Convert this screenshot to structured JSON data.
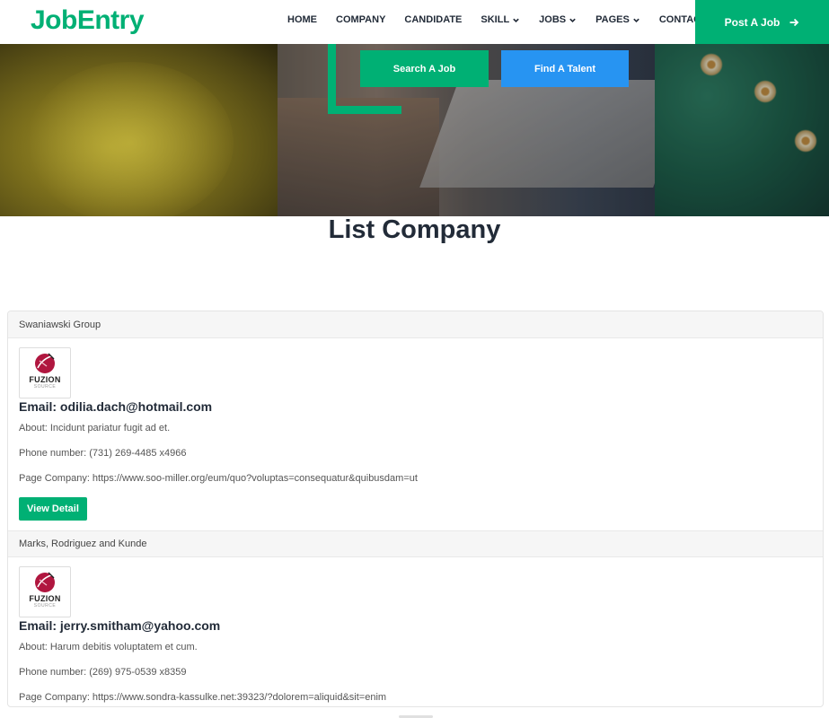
{
  "brand": {
    "logo": "JobEntry",
    "accent": "#00b074",
    "blue": "#2794f2"
  },
  "nav": {
    "items": [
      {
        "label": "HOME",
        "dropdown": false
      },
      {
        "label": "COMPANY",
        "dropdown": false
      },
      {
        "label": "CANDIDATE",
        "dropdown": false
      },
      {
        "label": "SKILL",
        "dropdown": true
      },
      {
        "label": "JOBS",
        "dropdown": true
      },
      {
        "label": "PAGES",
        "dropdown": true
      },
      {
        "label": "CONTACT",
        "dropdown": false
      }
    ],
    "post_job": "Post A Job",
    "post_job_icon": "arrow-right-icon"
  },
  "hero": {
    "search_job": "Search A Job",
    "find_talent": "Find A Talent"
  },
  "page": {
    "title": "List Company"
  },
  "companies": [
    {
      "name": "Swaniawski Group",
      "logo_text": "FUZION",
      "logo_sub": "SOURCE",
      "email_line": "Email: odilia.dach@hotmail.com",
      "about": "About: Incidunt pariatur fugit ad et.",
      "phone": "Phone number: (731) 269-4485 x4966",
      "page": "Page Company: https://www.soo-miller.org/eum/quo?voluptas=consequatur&quibusdam=ut",
      "button": "View Detail"
    },
    {
      "name": "Marks, Rodriguez and Kunde",
      "logo_text": "FUZION",
      "logo_sub": "SOURCE",
      "email_line": "Email: jerry.smitham@yahoo.com",
      "about": "About: Harum debitis voluptatem et cum.",
      "phone": "Phone number: (269) 975-0539 x8359",
      "page": "Page Company: https://www.sondra-kassulke.net:39323/?dolorem=aliquid&sit=enim",
      "button": "View Detail"
    }
  ]
}
